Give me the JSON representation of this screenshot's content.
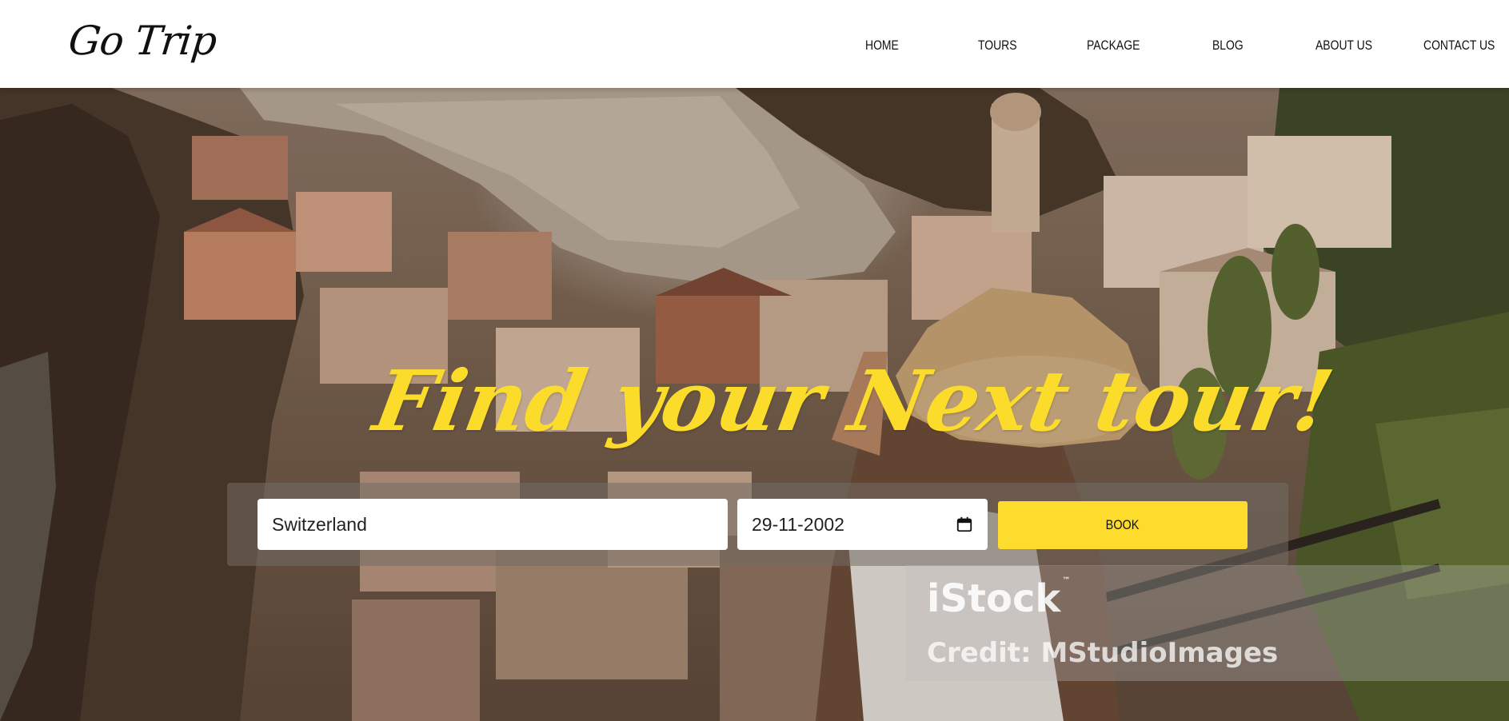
{
  "header": {
    "logo": "Go Trip",
    "nav": [
      {
        "label": "HOME"
      },
      {
        "label": "TOURS"
      },
      {
        "label": "PACKAGE"
      },
      {
        "label": "BLOG"
      },
      {
        "label": "ABOUT US"
      },
      {
        "label": "CONTACT US"
      }
    ]
  },
  "hero": {
    "headline": "Find your Next tour!",
    "search": {
      "destination_value": "Switzerland",
      "date_value": "29-11-2002",
      "book_label": "BOOK"
    },
    "watermark": {
      "brand": "iStock",
      "trademark": "™",
      "credit": "Credit: MStudioImages"
    }
  },
  "colors": {
    "accent_yellow": "#fddc2e",
    "headline_yellow": "#fbdc2b",
    "header_bg": "#ffffff",
    "text_dark": "#111111"
  },
  "icons": {
    "date_field": "calendar-icon"
  }
}
